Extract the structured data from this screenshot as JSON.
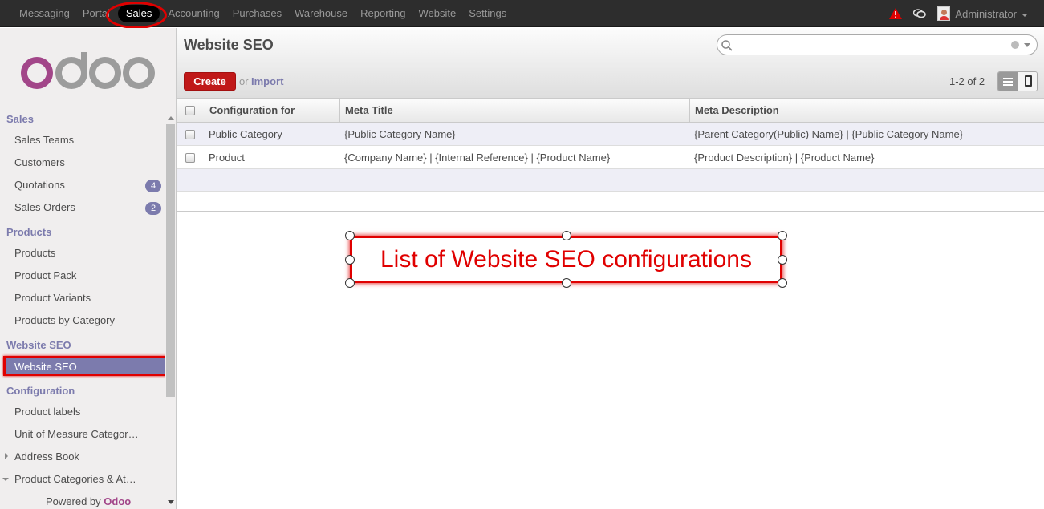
{
  "topbar": {
    "menu": [
      "Messaging",
      "Portal",
      "Sales",
      "Accounting",
      "Purchases",
      "Warehouse",
      "Reporting",
      "Website",
      "Settings"
    ],
    "active": "Sales",
    "user": "Administrator"
  },
  "sidebar": {
    "logo_text": "odoo",
    "sections": [
      {
        "header": "Sales",
        "items": [
          "Sales Teams",
          "Customers",
          "Quotations",
          "Sales Orders"
        ]
      },
      {
        "header": "Products",
        "items": [
          "Products",
          "Product Pack",
          "Product Variants",
          "Products by Category"
        ]
      },
      {
        "header": "Website SEO",
        "items": [
          "Website SEO"
        ]
      },
      {
        "header": "Configuration",
        "items": [
          "Product labels",
          "Unit of Measure Categor…",
          "Address Book",
          "Product Categories & At…"
        ]
      }
    ],
    "badges": {
      "quotations": "4",
      "sales_orders": "2"
    },
    "powered_by": "Powered by",
    "powered_brand": "Odoo"
  },
  "main": {
    "title": "Website SEO",
    "create_label": "Create",
    "or_label": "or",
    "import_label": "Import",
    "pager": "1-2 of 2",
    "columns": [
      "Configuration for",
      "Meta Title",
      "Meta Description"
    ],
    "rows": [
      [
        "Public Category",
        "{Public Category Name}",
        "{Parent Category(Public) Name} | {Public Category Name}"
      ],
      [
        "Product",
        "{Company Name} | {Internal Reference} | {Product Name}",
        "{Product Description} | {Product Name}"
      ]
    ]
  },
  "annotation": {
    "text": "List of Website SEO configurations"
  },
  "colors": {
    "accent": "#7c7bad",
    "create": "#c01818",
    "annotation": "#e00000",
    "brand": "#a24689"
  }
}
